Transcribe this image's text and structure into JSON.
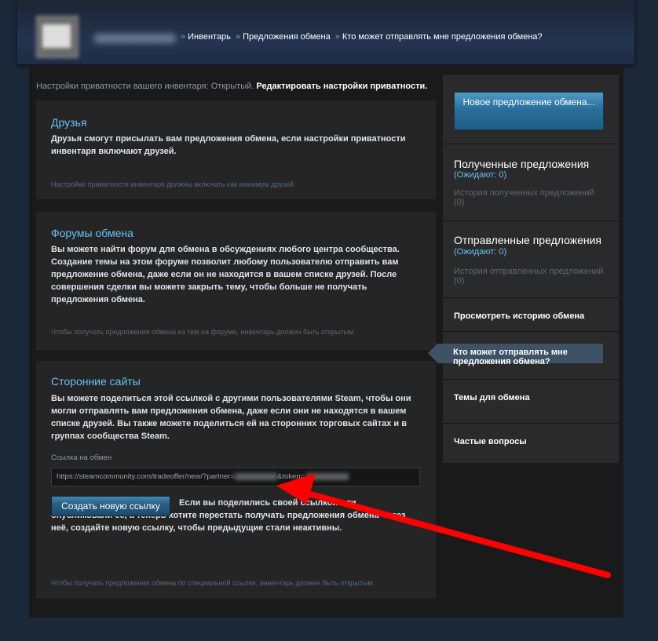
{
  "breadcrumb": {
    "sep": "»",
    "inventory": "Инвентарь",
    "offers": "Предложения обмена",
    "current": "Кто может отправлять мне предложения обмена?"
  },
  "privacy": {
    "text": "Настройки приватности вашего инвентаря: Открытый.",
    "edit_link": "Редактировать настройки приватности."
  },
  "friends": {
    "title": "Друзья",
    "desc": "Друзья смогут присылать вам предложения обмена, если настройки приватности инвентаря включают друзей.",
    "note": "Настройки приватности инвентаря должны включать как минимум друзей."
  },
  "forums": {
    "title": "Форумы обмена",
    "desc": "Вы можете найти форум для обмена в обсуждениях любого центра сообщества. Создание темы на этом форуме позволит любому пользователю отправить вам предложение обмена, даже если он не находится в вашем списке друзей. После совершения сделки вы можете закрыть тему, чтобы больше не получать предложения обмена.",
    "note": "Чтобы получать предложения обмена из тем на форуме, инвентарь должен быть открытым."
  },
  "third_party": {
    "title": "Сторонние сайты",
    "desc": "Вы можете поделиться этой ссылкой с другими пользователями Steam, чтобы они могли отправлять вам предложения обмена, даже если они не находятся в вашем списке друзей. Вы также можете поделиться ей на сторонних торговых сайтах и в группах сообщества Steam.",
    "link_label": "Ссылка на обмен",
    "link_prefix": "https://steamcommunity.com/tradeoffer/new/?partner=",
    "link_token": "&token=",
    "button": "Создать новую ссылку",
    "button_desc": "Если вы поделились своей ссылкой или опубликовали её, а теперь хотите перестать получать предложения обмена через неё, создайте новую ссылку, чтобы предыдущие стали неактивны.",
    "note": "Чтобы получать предложения обмена по специальной ссылке, инвентарь должен быть открытым."
  },
  "sidebar": {
    "new_offer": "Новое предложение обмена...",
    "received_title": "Полученные предложения",
    "received_wait": "(Ожидают: 0)",
    "received_history": "История полученных предложений (0)",
    "sent_title": "Отправленные предложения",
    "sent_wait": "(Ожидают: 0)",
    "sent_history": "История отправленных предложений (0)",
    "view_history": "Просмотреть историю обмена",
    "who_can": "Кто может отправлять мне предложения обмена?",
    "topics": "Темы для обмена",
    "faq": "Частые вопросы"
  },
  "colors": {
    "accent_blue": "#66c0f4",
    "annotation_red": "#ff0000"
  }
}
